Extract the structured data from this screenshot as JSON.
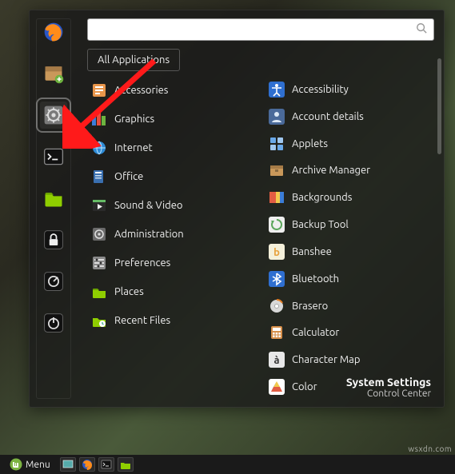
{
  "search": {
    "placeholder": ""
  },
  "filter": {
    "label": "All Applications"
  },
  "favorites": [
    {
      "name": "firefox"
    },
    {
      "name": "software-manager"
    },
    {
      "name": "system-settings",
      "selected": true
    },
    {
      "name": "terminal"
    },
    {
      "name": "file-manager"
    },
    {
      "name": "lock-screen"
    },
    {
      "name": "logout"
    },
    {
      "name": "shutdown"
    }
  ],
  "categories": [
    {
      "label": "Accessories",
      "icon": "accessories"
    },
    {
      "label": "Graphics",
      "icon": "graphics"
    },
    {
      "label": "Internet",
      "icon": "internet"
    },
    {
      "label": "Office",
      "icon": "office"
    },
    {
      "label": "Sound & Video",
      "icon": "sound-video"
    },
    {
      "label": "Administration",
      "icon": "administration"
    },
    {
      "label": "Preferences",
      "icon": "preferences"
    },
    {
      "label": "Places",
      "icon": "places"
    },
    {
      "label": "Recent Files",
      "icon": "recent-files"
    }
  ],
  "apps": [
    {
      "label": "Accessibility",
      "icon": "accessibility"
    },
    {
      "label": "Account details",
      "icon": "account-details"
    },
    {
      "label": "Applets",
      "icon": "applets"
    },
    {
      "label": "Archive Manager",
      "icon": "archive-manager"
    },
    {
      "label": "Backgrounds",
      "icon": "backgrounds"
    },
    {
      "label": "Backup Tool",
      "icon": "backup-tool"
    },
    {
      "label": "Banshee",
      "icon": "banshee"
    },
    {
      "label": "Bluetooth",
      "icon": "bluetooth"
    },
    {
      "label": "Brasero",
      "icon": "brasero"
    },
    {
      "label": "Calculator",
      "icon": "calculator"
    },
    {
      "label": "Character Map",
      "icon": "character-map"
    },
    {
      "label": "Color",
      "icon": "color"
    }
  ],
  "footer": {
    "title": "System Settings",
    "subtitle": "Control Center"
  },
  "taskbar": {
    "menu_label": "Menu"
  },
  "watermark": "wsxdn.com"
}
